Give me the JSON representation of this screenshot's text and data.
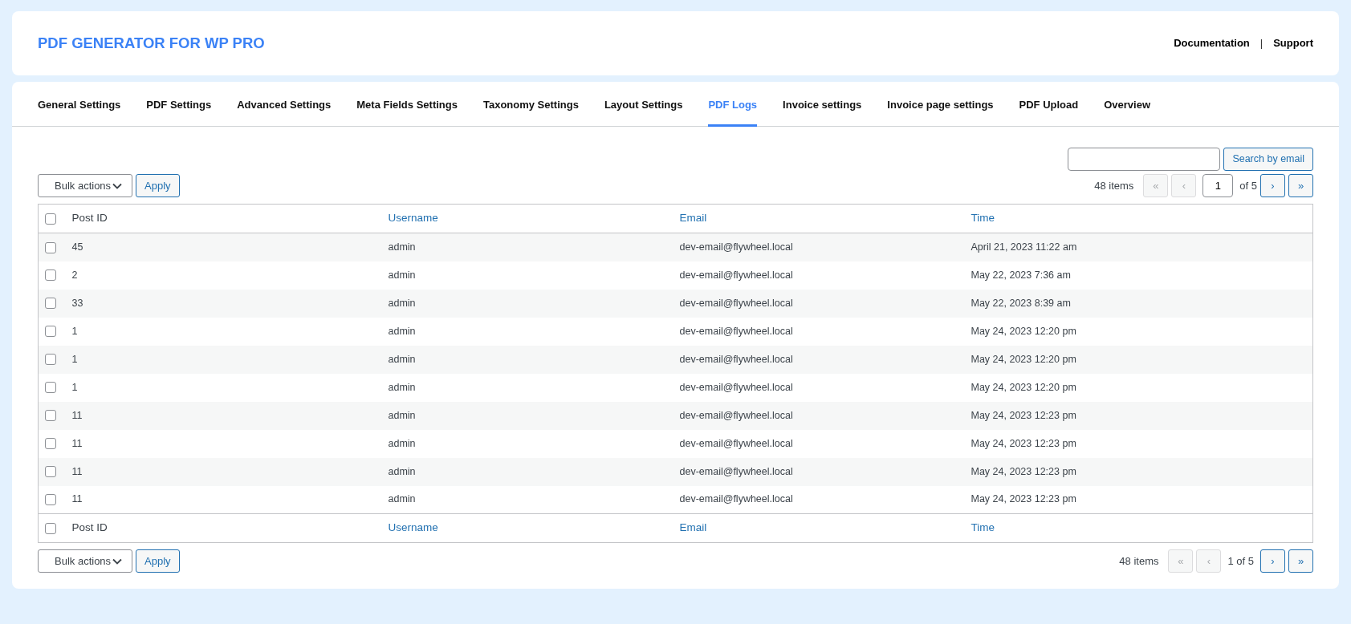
{
  "header": {
    "title": "PDF GENERATOR FOR WP PRO",
    "links": [
      "Documentation",
      "Support"
    ],
    "separator": "|"
  },
  "tabs": [
    {
      "label": "General Settings",
      "selected": false
    },
    {
      "label": "PDF Settings",
      "selected": false
    },
    {
      "label": "Advanced Settings",
      "selected": false
    },
    {
      "label": "Meta Fields Settings",
      "selected": false
    },
    {
      "label": "Taxonomy Settings",
      "selected": false
    },
    {
      "label": "Layout Settings",
      "selected": false
    },
    {
      "label": "PDF Logs",
      "selected": true
    },
    {
      "label": "Invoice settings",
      "selected": false
    },
    {
      "label": "Invoice page settings",
      "selected": false
    },
    {
      "label": "PDF Upload",
      "selected": false
    },
    {
      "label": "Overview",
      "selected": false
    }
  ],
  "search": {
    "button": "Search by email"
  },
  "top_nav": {
    "bulk_actions": "Bulk actions",
    "apply": "Apply",
    "items": "48 items",
    "page_input": "1",
    "of_pages": "of 5",
    "buttons": [
      {
        "label": "«",
        "disabled": true
      },
      {
        "label": "‹",
        "disabled": true
      },
      {
        "label": "›",
        "disabled": false
      },
      {
        "label": "»",
        "disabled": false
      }
    ]
  },
  "table": {
    "columns": [
      {
        "label": "Post ID",
        "sortable": false
      },
      {
        "label": "Username",
        "sortable": true
      },
      {
        "label": "Email",
        "sortable": true
      },
      {
        "label": "Time",
        "sortable": true
      }
    ],
    "header_checked": false,
    "rows": [
      {
        "checked": false,
        "cells": [
          "45",
          "admin",
          "dev-email@flywheel.local",
          "April 21, 2023 11:22 am"
        ]
      },
      {
        "checked": false,
        "cells": [
          "2",
          "admin",
          "dev-email@flywheel.local",
          "May 22, 2023 7:36 am"
        ]
      },
      {
        "checked": false,
        "cells": [
          "33",
          "admin",
          "dev-email@flywheel.local",
          "May 22, 2023 8:39 am"
        ]
      },
      {
        "checked": false,
        "cells": [
          "1",
          "admin",
          "dev-email@flywheel.local",
          "May 24, 2023 12:20 pm"
        ]
      },
      {
        "checked": false,
        "cells": [
          "1",
          "admin",
          "dev-email@flywheel.local",
          "May 24, 2023 12:20 pm"
        ]
      },
      {
        "checked": false,
        "cells": [
          "1",
          "admin",
          "dev-email@flywheel.local",
          "May 24, 2023 12:20 pm"
        ]
      },
      {
        "checked": false,
        "cells": [
          "11",
          "admin",
          "dev-email@flywheel.local",
          "May 24, 2023 12:23 pm"
        ]
      },
      {
        "checked": false,
        "cells": [
          "11",
          "admin",
          "dev-email@flywheel.local",
          "May 24, 2023 12:23 pm"
        ]
      },
      {
        "checked": false,
        "cells": [
          "11",
          "admin",
          "dev-email@flywheel.local",
          "May 24, 2023 12:23 pm"
        ]
      },
      {
        "checked": false,
        "cells": [
          "11",
          "admin",
          "dev-email@flywheel.local",
          "May 24, 2023 12:23 pm"
        ]
      }
    ],
    "footer_columns": [
      {
        "label": "Post ID",
        "sortable": false
      },
      {
        "label": "Username",
        "sortable": true
      },
      {
        "label": "Email",
        "sortable": true
      },
      {
        "label": "Time",
        "sortable": true
      }
    ],
    "footer_checked": false
  },
  "bottom_nav": {
    "bulk_actions": "Bulk actions",
    "apply": "Apply",
    "items": "48 items",
    "pages": "1 of 5",
    "buttons": [
      {
        "label": "«",
        "disabled": true
      },
      {
        "label": "‹",
        "disabled": true
      },
      {
        "label": "›",
        "disabled": false
      },
      {
        "label": "»",
        "disabled": false
      }
    ]
  }
}
